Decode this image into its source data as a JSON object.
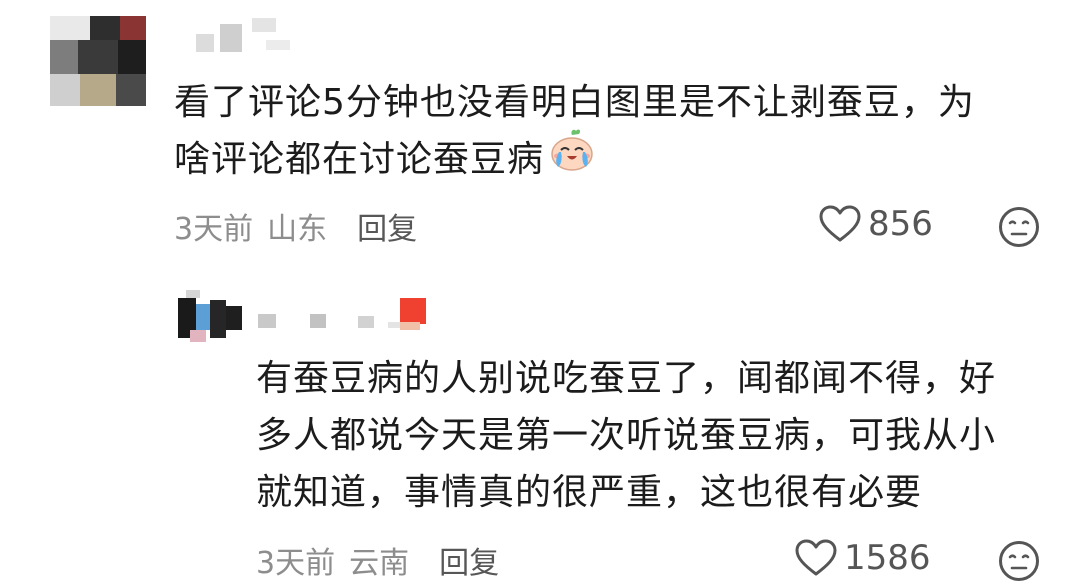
{
  "comments": [
    {
      "text_lines": [
        "看了评论5分钟也没看明白图里是不让剥蚕豆，为",
        "啥评论都在讨论蚕豆病"
      ],
      "emoji": "crying-face-emoji",
      "time": "3天前",
      "location": "山东",
      "reply_label": "回复",
      "likes": "856"
    },
    {
      "text_lines": [
        "有蚕豆病的人别说吃蚕豆了，闻都闻不得，好",
        "多人都说今天是第一次听说蚕豆病，可我从小",
        "就知道，事情真的很严重，这也很有必要"
      ],
      "time": "3天前",
      "location": "云南",
      "reply_label": "回复",
      "likes": "1586"
    }
  ],
  "icons": {
    "like": "heart-outline-icon",
    "dislike": "neutral-face-icon"
  },
  "colors": {
    "text": "#1c1c1c",
    "meta": "#8d8d8d",
    "icon": "#555555"
  }
}
